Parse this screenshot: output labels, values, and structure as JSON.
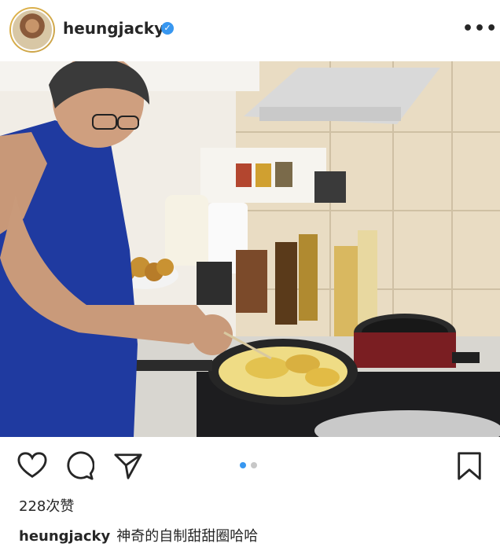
{
  "header": {
    "username": "heungjacky",
    "verified_icon": "verified-badge-icon",
    "more_icon": "more-options-icon"
  },
  "post": {
    "image_alt_icon": "photo",
    "carousel": {
      "count": 2,
      "active_index": 0
    },
    "actions": {
      "like_icon": "heart-icon",
      "comment_icon": "comment-icon",
      "share_icon": "share-icon",
      "save_icon": "bookmark-icon"
    },
    "likes_text": "228次赞",
    "caption": {
      "username": "heungjacky",
      "text": "神奇的自制甜甜圈哈哈"
    }
  },
  "colors": {
    "accent": "#3897f0",
    "text": "#262626",
    "dot_inactive": "#c7c7c7"
  }
}
